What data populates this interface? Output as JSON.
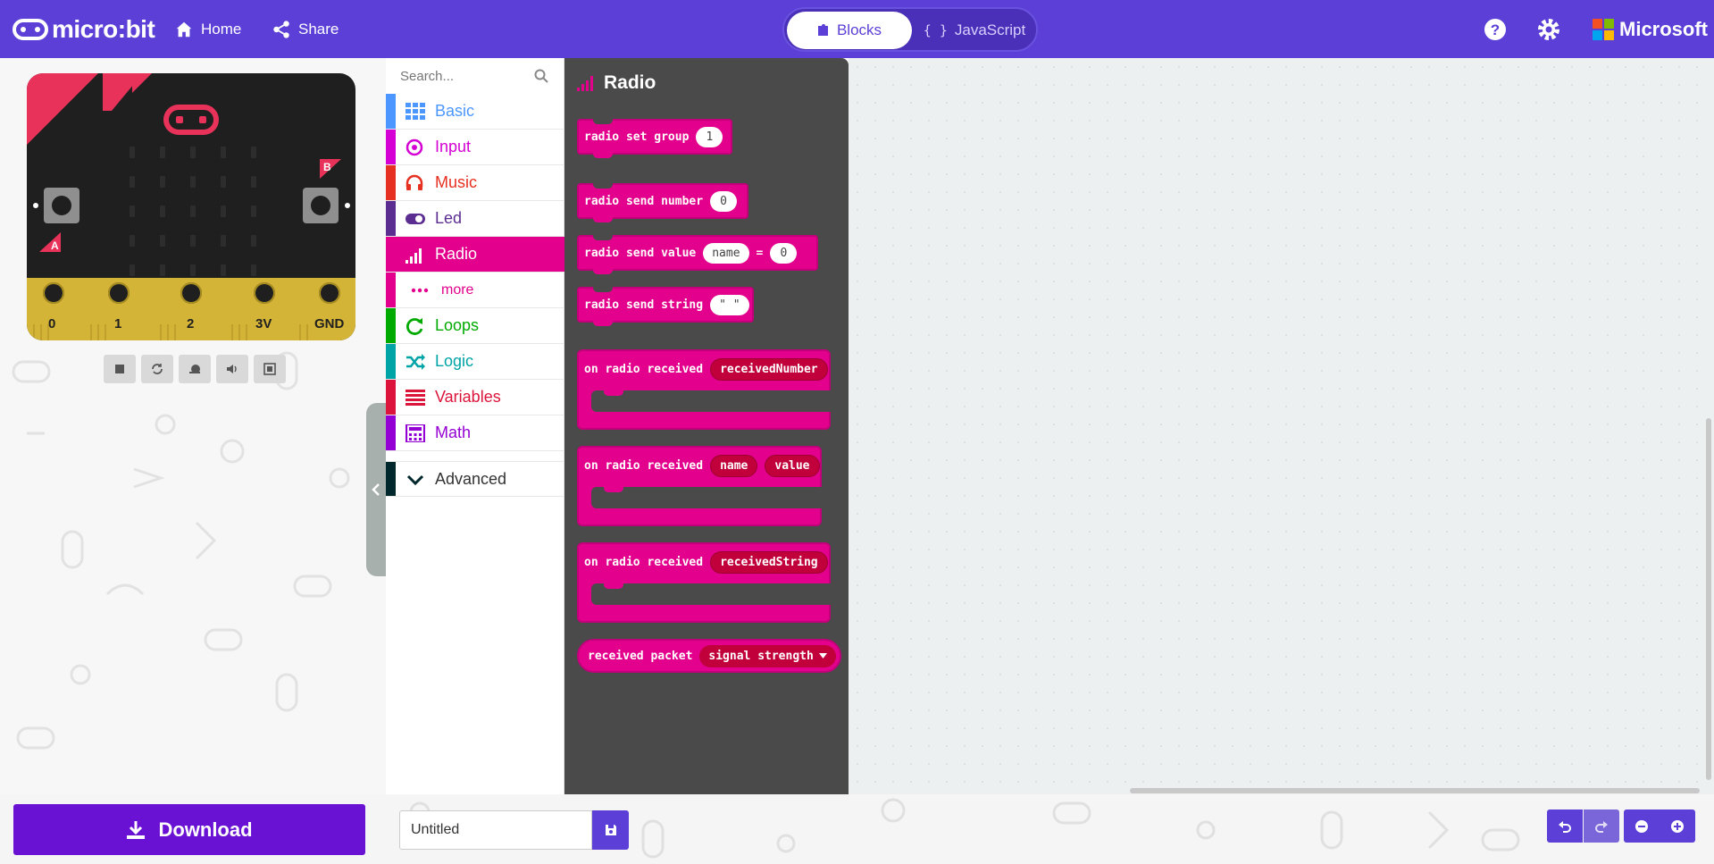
{
  "header": {
    "logo_text": "micro:bit",
    "home_label": "Home",
    "share_label": "Share",
    "blocks_label": "Blocks",
    "javascript_label": "JavaScript",
    "brand_label": "Microsoft"
  },
  "simulator": {
    "pins": [
      "0",
      "1",
      "2",
      "3V",
      "GND"
    ],
    "button_a": "A",
    "button_b": "B"
  },
  "toolbox": {
    "search_placeholder": "Search...",
    "categories": [
      {
        "label": "Basic",
        "color": "#4c97ff"
      },
      {
        "label": "Input",
        "color": "#d400d4"
      },
      {
        "label": "Music",
        "color": "#e63022"
      },
      {
        "label": "Led",
        "color": "#5c2d91"
      },
      {
        "label": "Radio",
        "color": "#e3008c"
      },
      {
        "label": "more",
        "color": "#e3008c"
      },
      {
        "label": "Loops",
        "color": "#00aa00"
      },
      {
        "label": "Logic",
        "color": "#00a4a6"
      },
      {
        "label": "Variables",
        "color": "#dc143c"
      },
      {
        "label": "Math",
        "color": "#9400d3"
      },
      {
        "label": "Advanced",
        "color": "#00272b"
      }
    ]
  },
  "flyout": {
    "title": "Radio",
    "set_group": {
      "text": "radio set group",
      "value": "1"
    },
    "send_number": {
      "text": "radio send number",
      "value": "0"
    },
    "send_value": {
      "text": "radio send value",
      "name": "name",
      "eq": "=",
      "value": "0"
    },
    "send_string": {
      "text": "radio send string",
      "value": "\" \""
    },
    "on_received_number": {
      "text": "on radio received",
      "param": "receivedNumber"
    },
    "on_received_value": {
      "text": "on radio received",
      "param1": "name",
      "param2": "value"
    },
    "on_received_string": {
      "text": "on radio received",
      "param": "receivedString"
    },
    "received_packet": {
      "text": "received packet",
      "option": "signal strength"
    }
  },
  "footer": {
    "download_label": "Download",
    "project_name": "Untitled"
  },
  "colors": {
    "header": "#5c3fd6",
    "radio": "#e3008c",
    "download": "#6a12d4"
  }
}
